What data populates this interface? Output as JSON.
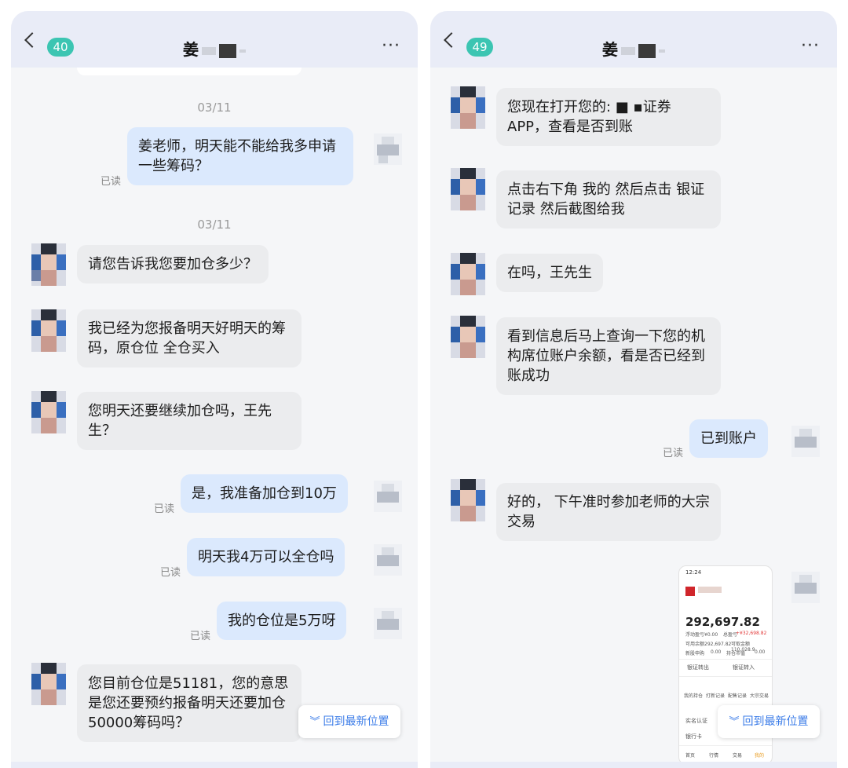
{
  "colors": {
    "header_bg": "#e9ecf7",
    "badge": "#3cc5b2",
    "incoming": "#ebecee",
    "outgoing": "#dbe9fd",
    "link": "#3b7ce8"
  },
  "left": {
    "badge": "40",
    "title": "姜",
    "timestamps": [
      "03/11",
      "03/11"
    ],
    "messages": [
      "姜老师，明天能不能给我多申请一些筹码？",
      "请您告诉我您要加仓多少？",
      "我已经为您报备明天好明天的筹码，原仓位 全仓买入",
      "您明天还要继续加仓吗，王先生？",
      "是，我准备加仓到10万",
      "明天我4万可以全仓吗",
      "我的仓位是5万呀",
      "您目前仓位是51181，您的意思是您还要预约报备明天还要加仓50000筹码吗？"
    ],
    "read_label": "已读",
    "jump_label": "回到最新位置"
  },
  "right": {
    "badge": "49",
    "title": "姜",
    "messages": [
      "您现在打开您的: ■ ▪证券APP，查看是否到账",
      "点击右下角 我的 然后点击 银证记录 然后截图给我",
      "在吗，王先生",
      "看到信息后马上查询一下您的机构席位账户余额，看是否已经到账成功",
      "已到账户",
      "好的， 下午准时参加老师的大宗交易"
    ],
    "read_label": "已读",
    "jump_label": "回到最新位置",
    "screenshot": {
      "status_time": "12:24",
      "balance": "292,697.82",
      "line1a": "浮动盈亏¥0.00",
      "line1b": "总盈亏",
      "line1c": "+¥32,698.82",
      "line2a": "可用余额292,697.82",
      "line2b": "可取金额110,028.9",
      "line3a": "新股申购",
      "line3b": "0.00",
      "line3c": "持仓市值",
      "line3d": "0.00",
      "btn_out": "银证转出",
      "btn_in": "银证转入",
      "grid": [
        "我的持仓",
        "打新记录",
        "配售记录",
        "大宗交易"
      ],
      "list": [
        "实名认证",
        "银行卡"
      ],
      "tabs": [
        "首页",
        "行情",
        "交易",
        "我的"
      ]
    }
  }
}
